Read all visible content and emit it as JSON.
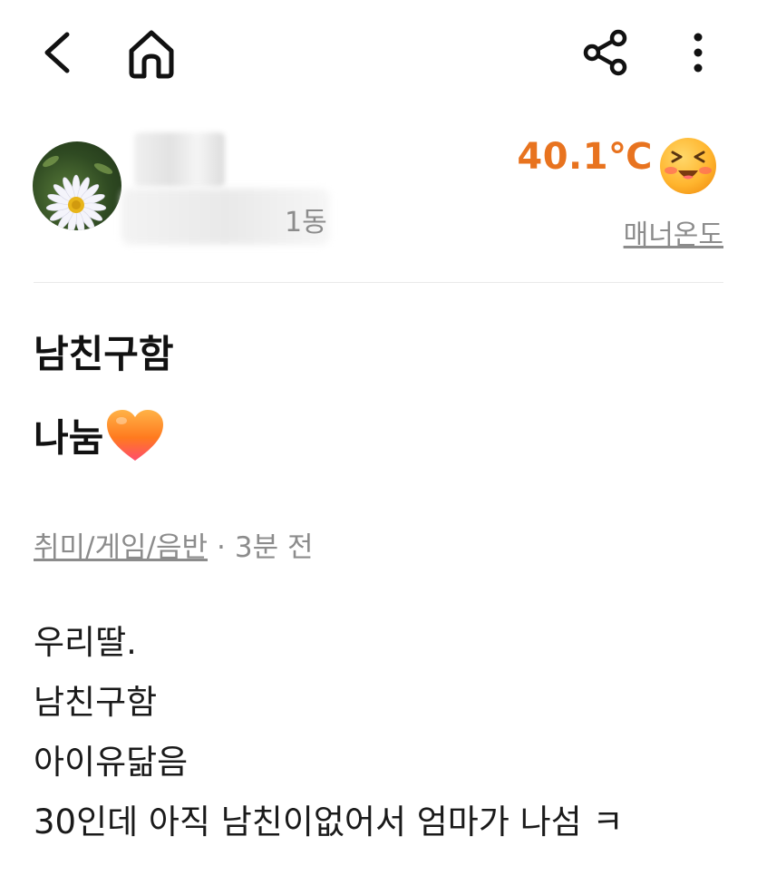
{
  "toolbar": {
    "back_icon": "chevron-left-icon",
    "home_icon": "home-icon",
    "share_icon": "share-icon",
    "more_icon": "more-vertical-icon"
  },
  "profile": {
    "region_visible_tail": "1동",
    "manner_temp": "40.1℃",
    "manner_label": "매너온도",
    "manner_color": "#e8731f",
    "manner_emoji": "laughing-face-icon"
  },
  "post": {
    "title_lines": [
      "남친구함",
      "나눔"
    ],
    "title_emoji": "orange-heart-icon",
    "category": "취미/게임/음반",
    "separator": "·",
    "time_ago": "3분 전",
    "body_lines": [
      "우리딸.",
      "남친구함",
      "아이유닮음",
      "30인데 아직 남친이없어서 엄마가 나섬 ㅋ"
    ]
  }
}
